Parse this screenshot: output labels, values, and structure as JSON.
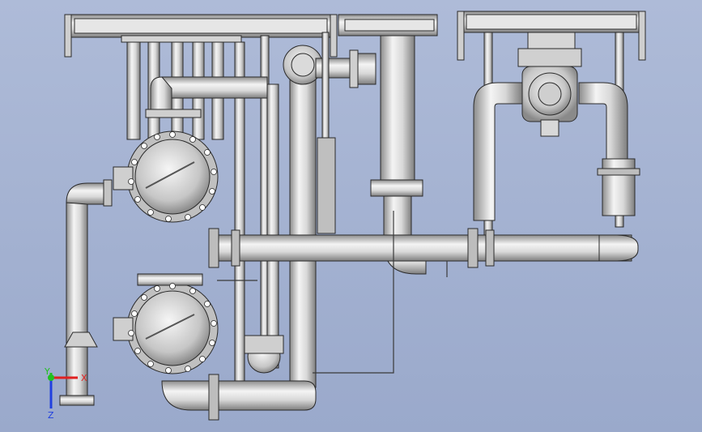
{
  "viewport": {
    "background_top": "#aebbd8",
    "background_bottom": "#9aa9cb"
  },
  "colors": {
    "steel_light": "#f2f2f2",
    "steel_mid": "#c9c9c9",
    "steel_dark": "#8c8c8c",
    "outline": "#2a2a2a",
    "bolt": "#ffffff"
  },
  "triad": {
    "x_label": "X",
    "y_label": "Y",
    "z_label": "Z",
    "x_color": "#e02020",
    "y_color": "#20c020",
    "z_color": "#2040e0"
  }
}
